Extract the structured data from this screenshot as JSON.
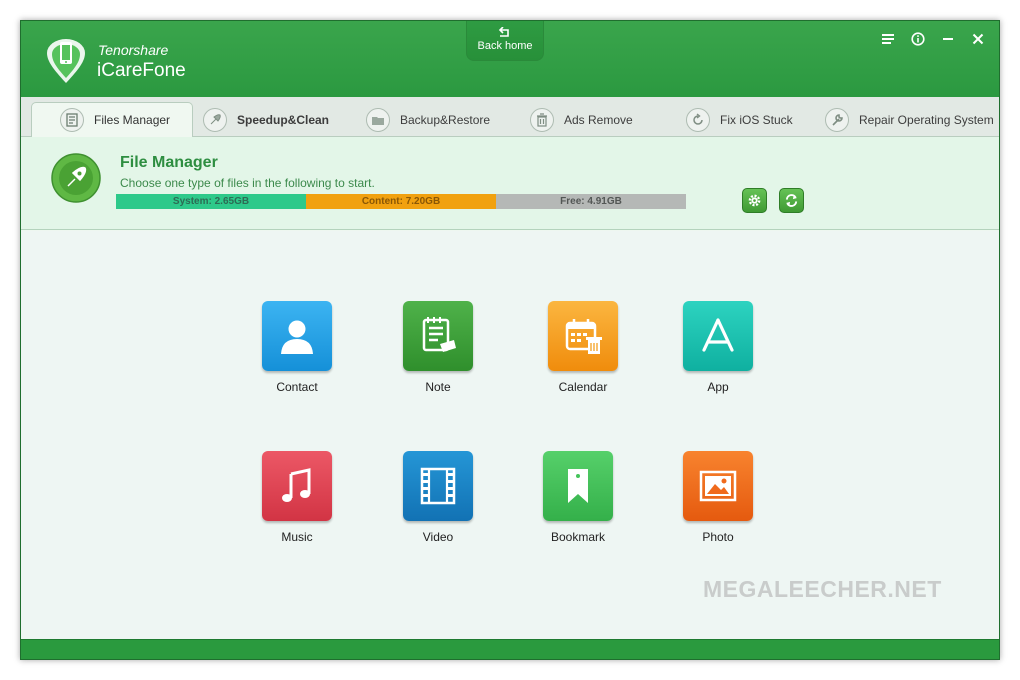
{
  "app": {
    "brand_small": "Tenorshare",
    "brand_big": "iCareFone",
    "back_home": "Back home",
    "colors": {
      "titlebar": "#2e9e43",
      "accent": "#2e8e41"
    }
  },
  "window_controls": [
    {
      "icon": "menu-icon"
    },
    {
      "icon": "info-icon"
    },
    {
      "icon": "minimize-icon"
    },
    {
      "icon": "close-icon"
    }
  ],
  "tabs": [
    {
      "label": "Files Manager",
      "icon": "files-manager-icon",
      "active": true
    },
    {
      "label": "Speedup&Clean",
      "icon": "rocket-icon",
      "active": false
    },
    {
      "label": "Backup&Restore",
      "icon": "backup-icon",
      "active": false
    },
    {
      "label": "Ads Remove",
      "icon": "ads-remove-icon",
      "active": false
    },
    {
      "label": "Fix iOS Stuck",
      "icon": "fix-icon",
      "active": false
    },
    {
      "label": "Repair Operating System",
      "icon": "wrench-icon",
      "active": false
    }
  ],
  "file_manager": {
    "title": "File Manager",
    "subtitle": "Choose one type of files in the following to start.",
    "storage": {
      "system": "System: 2.65GB",
      "content": "Content: 7.20GB",
      "free": "Free: 4.91GB"
    }
  },
  "tiles": [
    {
      "label": "Contact",
      "icon": "contact-icon",
      "color": "#1fa0e8"
    },
    {
      "label": "Note",
      "icon": "note-icon",
      "color": "#3ea23a"
    },
    {
      "label": "Calendar",
      "icon": "calendar-icon",
      "color": "#f9a21d"
    },
    {
      "label": "App",
      "icon": "app-store-icon",
      "color": "#15c4b2"
    },
    {
      "label": "Music",
      "icon": "music-icon",
      "color": "#e04450"
    },
    {
      "label": "Video",
      "icon": "video-icon",
      "color": "#1a86c8"
    },
    {
      "label": "Bookmark",
      "icon": "bookmark-icon",
      "color": "#44c45a"
    },
    {
      "label": "Photo",
      "icon": "photo-icon",
      "color": "#f06a1c"
    }
  ],
  "watermark": "MEGALEECHER.NET"
}
